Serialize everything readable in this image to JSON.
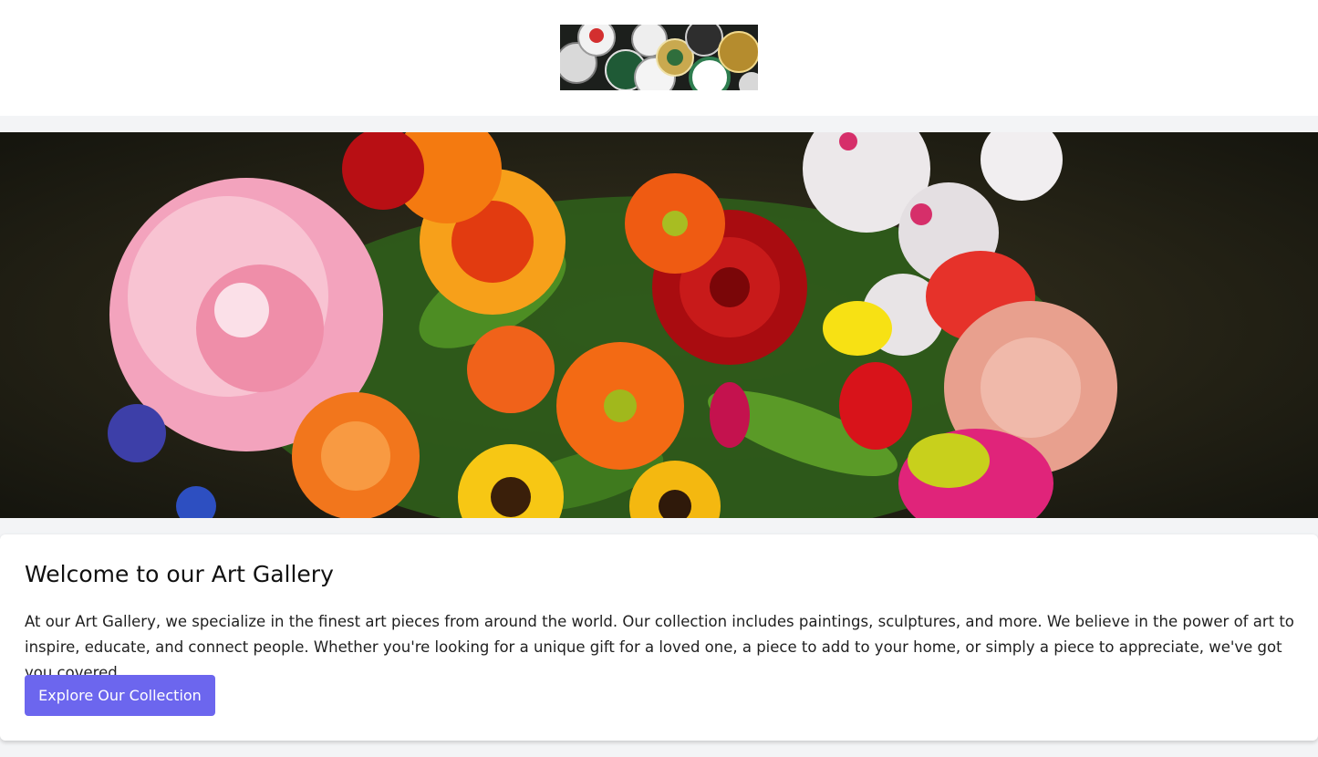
{
  "header": {
    "logo_icon": "bottle-caps-logo-icon"
  },
  "hero": {
    "image_icon": "flower-bouquet-image-icon",
    "colors": {
      "background": "#2a2718",
      "pink": "#f3a3bd",
      "red": "#c20f12",
      "orange": "#f36a14",
      "yellow": "#f7c714",
      "white": "#ece8ea",
      "green": "#3f8a1f"
    }
  },
  "main": {
    "title": "Welcome to our Art Gallery",
    "description": "At our Art Gallery, we specialize in the finest art pieces from around the world. Our collection includes paintings, sculptures, and more. We believe in the power of art to inspire, educate, and connect people. Whether you're looking for a unique gift for a loved one, a piece to add to your home, or simply a piece to appreciate, we've got you covered.",
    "cta_label": "Explore Our Collection"
  },
  "colors": {
    "page_background": "#f3f4f6",
    "card_background": "#ffffff",
    "accent": "#6c66ee"
  }
}
